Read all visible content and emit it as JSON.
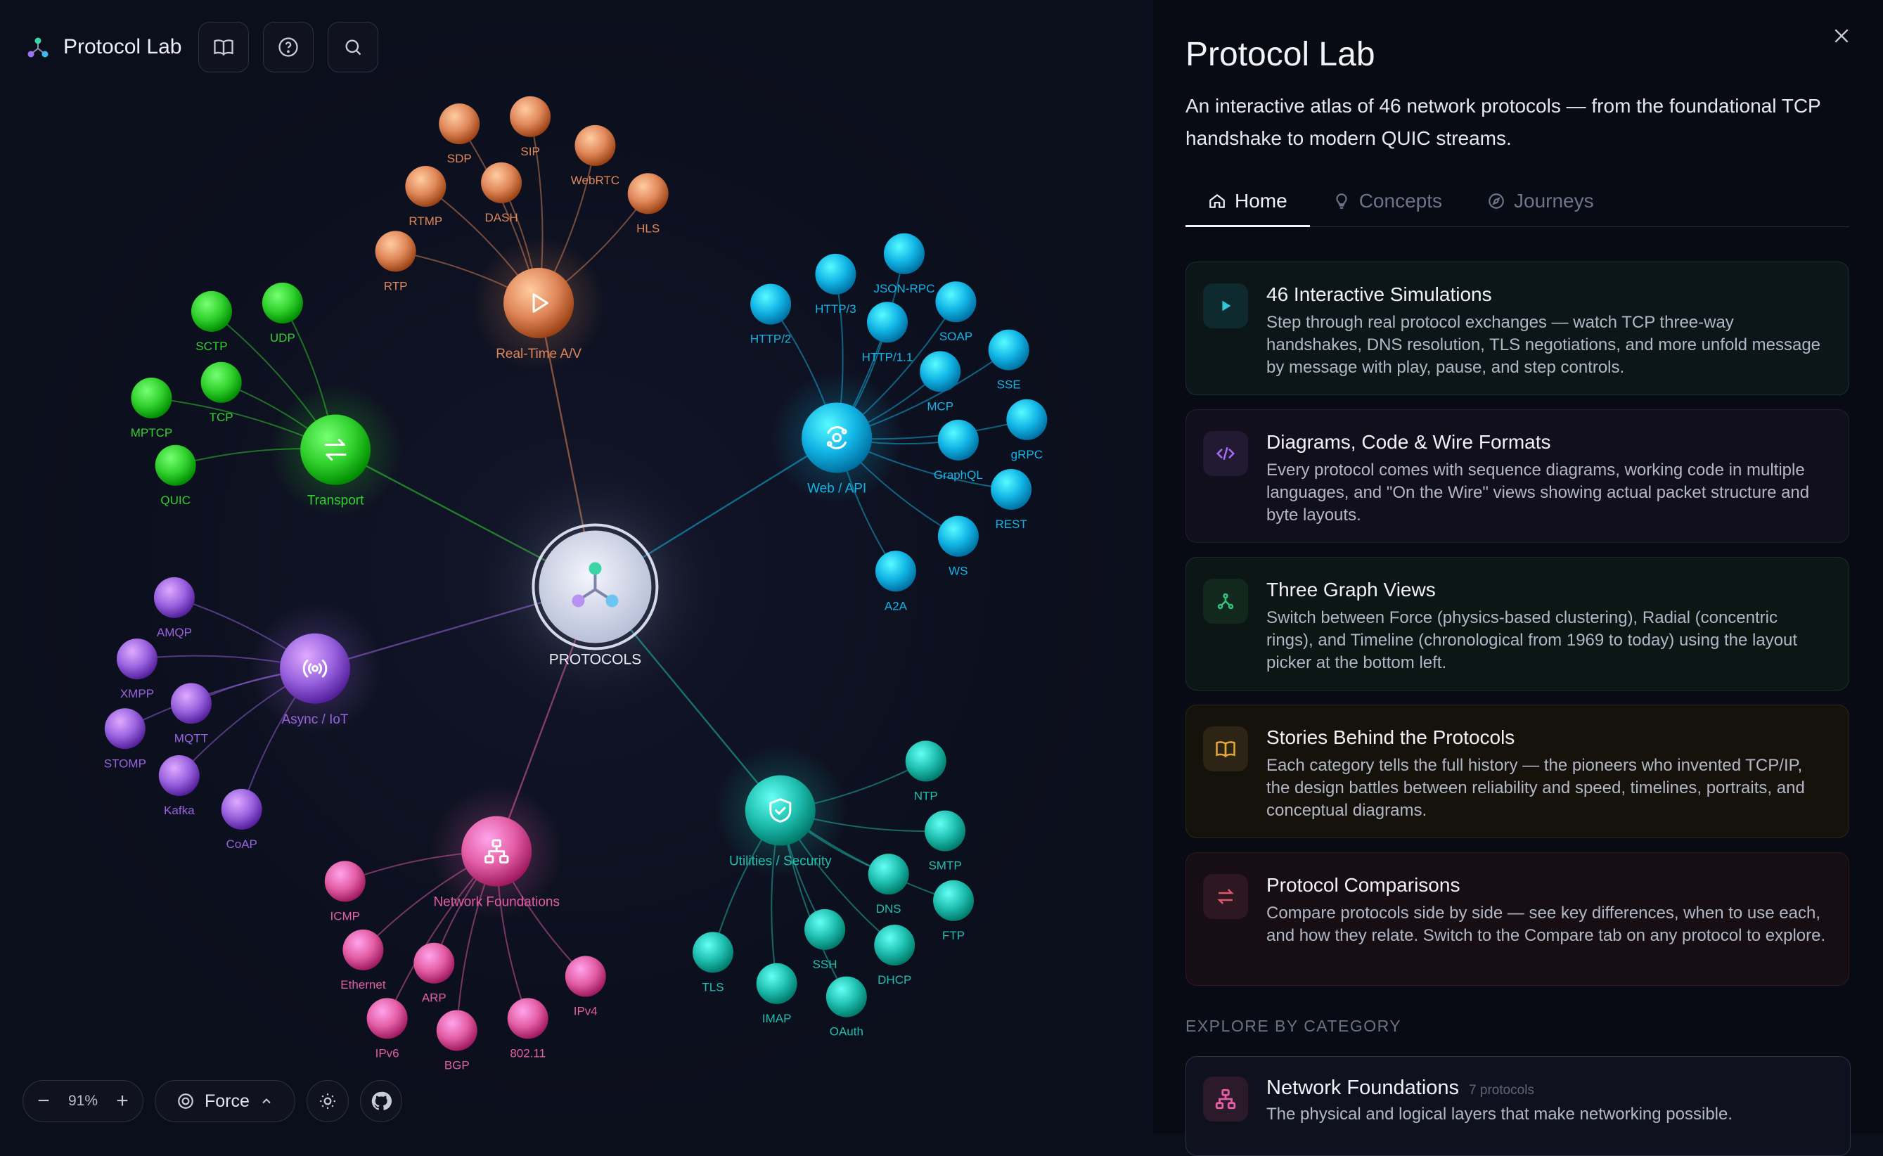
{
  "app": {
    "name": "Protocol Lab"
  },
  "graph": {
    "center_label": "PROTOCOLS",
    "categories": [
      {
        "key": "realtime",
        "label": "Real-Time A/V",
        "color": "#e0875a",
        "icon": "play-icon",
        "children": [
          "SDP",
          "SIP",
          "WebRTC",
          "HLS",
          "RTMP",
          "DASH",
          "RTP"
        ]
      },
      {
        "key": "transport",
        "label": "Transport",
        "color": "#31d12e",
        "icon": "arrows-swap-icon",
        "children": [
          "SCTP",
          "UDP",
          "TCP",
          "MPTCP",
          "QUIC"
        ]
      },
      {
        "key": "web",
        "label": "Web / API",
        "color": "#12b5e6",
        "icon": "orbit-icon",
        "children": [
          "HTTP/3",
          "JSON-RPC",
          "HTTP/2",
          "SOAP",
          "HTTP/1.1",
          "SSE",
          "MCP",
          "gRPC",
          "GraphQL",
          "REST",
          "WS",
          "A2A"
        ]
      },
      {
        "key": "async",
        "label": "Async / IoT",
        "color": "#9a64e0",
        "icon": "broadcast-icon",
        "children": [
          "AMQP",
          "XMPP",
          "MQTT",
          "STOMP",
          "Kafka",
          "CoAP"
        ]
      },
      {
        "key": "network",
        "label": "Network Foundations",
        "color": "#e35ea5",
        "icon": "network-icon",
        "children": [
          "ICMP",
          "Ethernet",
          "ARP",
          "IPv4",
          "IPv6",
          "BGP",
          "802.11"
        ]
      },
      {
        "key": "utilities",
        "label": "Utilities / Security",
        "color": "#1fbfb0",
        "icon": "shield-check-icon",
        "children": [
          "NTP",
          "SMTP",
          "DNS",
          "FTP",
          "SSH",
          "DHCP",
          "TLS",
          "IMAP",
          "OAuth"
        ]
      }
    ]
  },
  "controls": {
    "zoom": "91%",
    "zoom_out": "−",
    "zoom_in": "+",
    "layout": "Force"
  },
  "panel": {
    "title": "Protocol Lab",
    "description": "An interactive atlas of 46 network protocols — from the foundational TCP handshake to modern QUIC streams.",
    "tabs": [
      {
        "label": "Home",
        "icon": "home-icon"
      },
      {
        "label": "Concepts",
        "icon": "lightbulb-icon"
      },
      {
        "label": "Journeys",
        "icon": "compass-icon"
      }
    ],
    "features": [
      {
        "title": "46 Interactive Simulations",
        "desc": "Step through real protocol exchanges — watch TCP three-way handshakes, DNS resolution, TLS negotiations, and more unfold message by message with play, pause, and step controls.",
        "icon": "play-icon",
        "color": "#2fc7d6"
      },
      {
        "title": "Diagrams, Code & Wire Formats",
        "desc": "Every protocol comes with sequence diagrams, working code in multiple languages, and \"On the Wire\" views showing actual packet structure and byte layouts.",
        "icon": "code-icon",
        "color": "#a36ef0"
      },
      {
        "title": "Three Graph Views",
        "desc": "Switch between Force (physics-based clustering), Radial (concentric rings), and Timeline (chronological from 1969 to today) using the layout picker at the bottom left.",
        "icon": "graph-icon",
        "color": "#35c27a"
      },
      {
        "title": "Stories Behind the Protocols",
        "desc": "Each category tells the full history — the pioneers who invented TCP/IP, the design battles between reliability and speed, timelines, portraits, and conceptual diagrams.",
        "icon": "book-icon",
        "color": "#e7a93a"
      },
      {
        "title": "Protocol Comparisons",
        "desc": "Compare protocols side by side — see key differences, when to use each, and how they relate. Switch to the Compare tab on any protocol to explore.",
        "icon": "arrows-swap-icon",
        "color": "#e0556a"
      }
    ],
    "explore_heading": "EXPLORE BY CATEGORY",
    "category_card": {
      "title": "Network Foundations",
      "count": "7 protocols",
      "desc": "The physical and logical layers that make networking possible.",
      "icon": "network-icon"
    }
  }
}
